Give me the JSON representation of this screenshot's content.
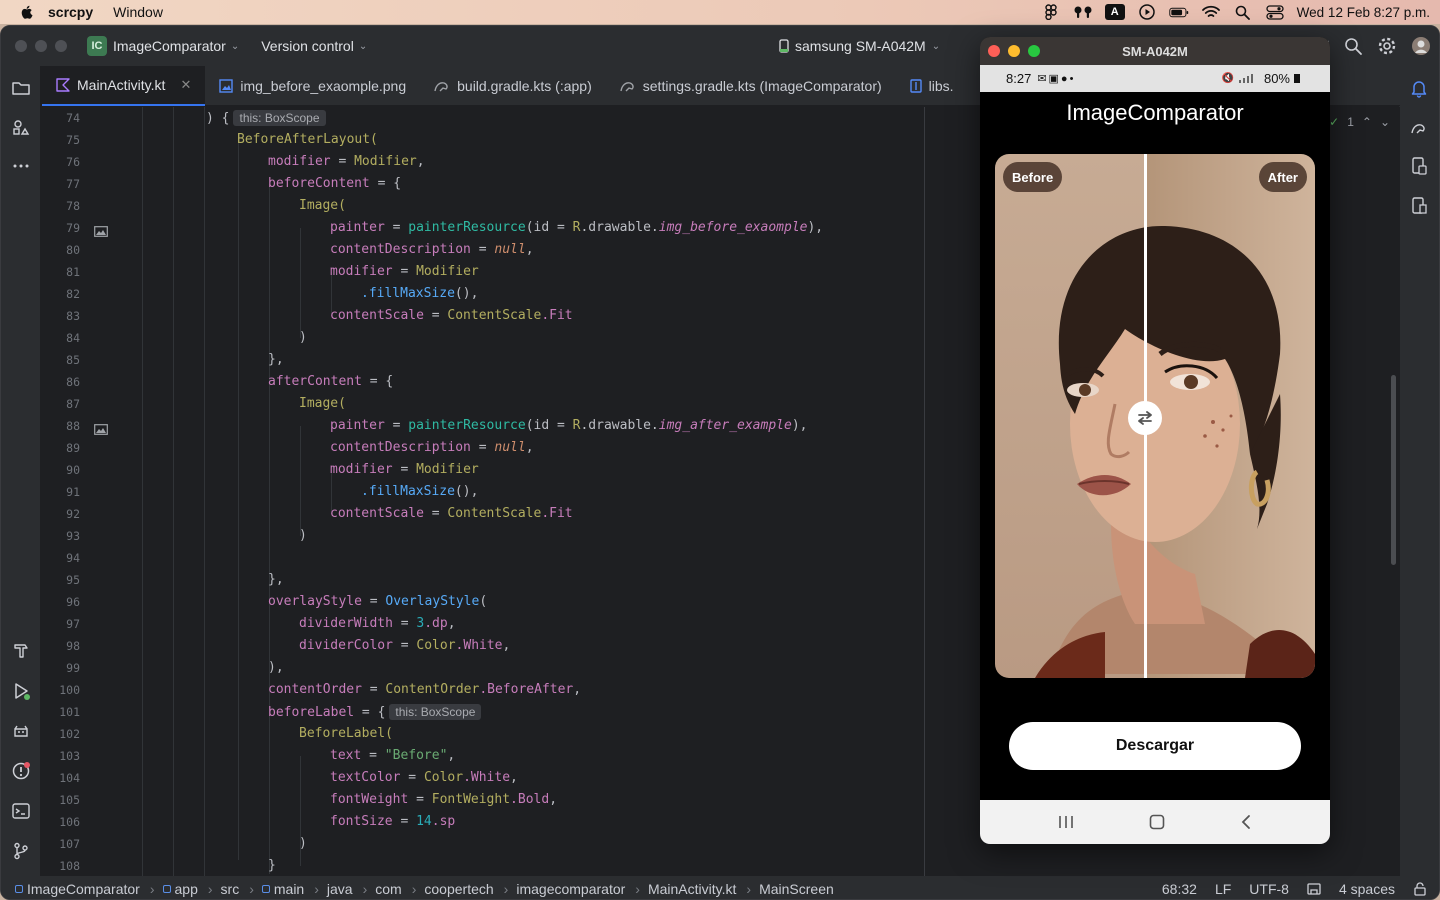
{
  "menubar": {
    "app_name": "scrcpy",
    "menus": [
      "Window"
    ],
    "input_badge": "A",
    "datetime": "Wed 12 Feb  8:27 p.m."
  },
  "ide": {
    "project_badge": "IC",
    "project_name": "ImageComparator",
    "vcs_label": "Version control",
    "device_name": "samsung SM-A042M",
    "tabs": [
      {
        "label": "MainActivity.kt",
        "icon": "kotlin-file-icon",
        "active": true
      },
      {
        "label": "img_before_exaomple.png",
        "icon": "image-file-icon"
      },
      {
        "label": "build.gradle.kts (:app)",
        "icon": "gradle-icon"
      },
      {
        "label": "settings.gradle.kts (ImageComparator)",
        "icon": "gradle-icon"
      },
      {
        "label": "libs.",
        "icon": "toml-file-icon"
      }
    ],
    "inspection_count": "1",
    "line_numbers": [
      "74",
      "75",
      "76",
      "77",
      "78",
      "79",
      "80",
      "81",
      "82",
      "83",
      "84",
      "85",
      "86",
      "87",
      "88",
      "89",
      "90",
      "91",
      "92",
      "93",
      "94",
      "95",
      "96",
      "97",
      "98",
      "99",
      "100",
      "101",
      "102",
      "103",
      "104",
      "105",
      "106",
      "107",
      "108"
    ],
    "code": {
      "l74a": ") {",
      "l74hint": "this: BoxScope",
      "l75": "BeforeAfterLayout(",
      "modifier": "modifier",
      "eq": " = ",
      "Modifier": "Modifier",
      "comma": ",",
      "beforeContent": "beforeContent",
      "afterContent": "afterContent",
      "openBrace": " = {",
      "Image": "Image(",
      "painter": "painter",
      "painterResource": "painterResource",
      "idEq": "(id = ",
      "R": "R",
      "drawable": ".drawable.",
      "img_before": "img_before_exaomple",
      "img_after": "img_after_example",
      "closeComma": "),",
      "contentDescription": "contentDescription",
      "null": "null",
      "fillMaxSize": ".fillMaxSize",
      "parens": "(),",
      "contentScale": "contentScale",
      "ContentScale": "ContentScale",
      "Fit": ".Fit",
      "closeParen": ")",
      "closeBraceComma": "},",
      "overlayStyle": "overlayStyle",
      "OverlayStyle": "OverlayStyle",
      "openParen": "(",
      "dividerWidth": "dividerWidth",
      "n3": "3",
      "dp": ".dp",
      "dividerColor": "dividerColor",
      "Color": "Color",
      "White": ".White",
      "contentOrder": "contentOrder",
      "ContentOrder": "ContentOrder",
      "BeforeAfter": ".BeforeAfter",
      "beforeLabel": "beforeLabel",
      "beforeLabelOpen": " = {",
      "hint101": "this: BoxScope",
      "BeforeLabel": "BeforeLabel(",
      "text": "text",
      "BeforeStr": "\"Before\"",
      "textColor": "textColor",
      "fontWeight": "fontWeight",
      "FontWeight": "FontWeight",
      "Bold": ".Bold",
      "fontSize": "fontSize",
      "n14": "14",
      "sp": ".sp",
      "l108": "}"
    },
    "breadcrumbs": [
      "ImageComparator",
      "app",
      "src",
      "main",
      "java",
      "com",
      "coopertech",
      "imagecomparator",
      "MainActivity.kt",
      "MainScreen"
    ],
    "status": {
      "position": "68:32",
      "line_sep": "LF",
      "encoding": "UTF-8",
      "indent": "4 spaces"
    }
  },
  "phone": {
    "window_title": "SM-A042M",
    "time": "8:27",
    "battery": "80%",
    "app_title": "ImageComparator",
    "before_label": "Before",
    "after_label": "After",
    "divider_position": 0.47,
    "download_button": "Descargar"
  }
}
